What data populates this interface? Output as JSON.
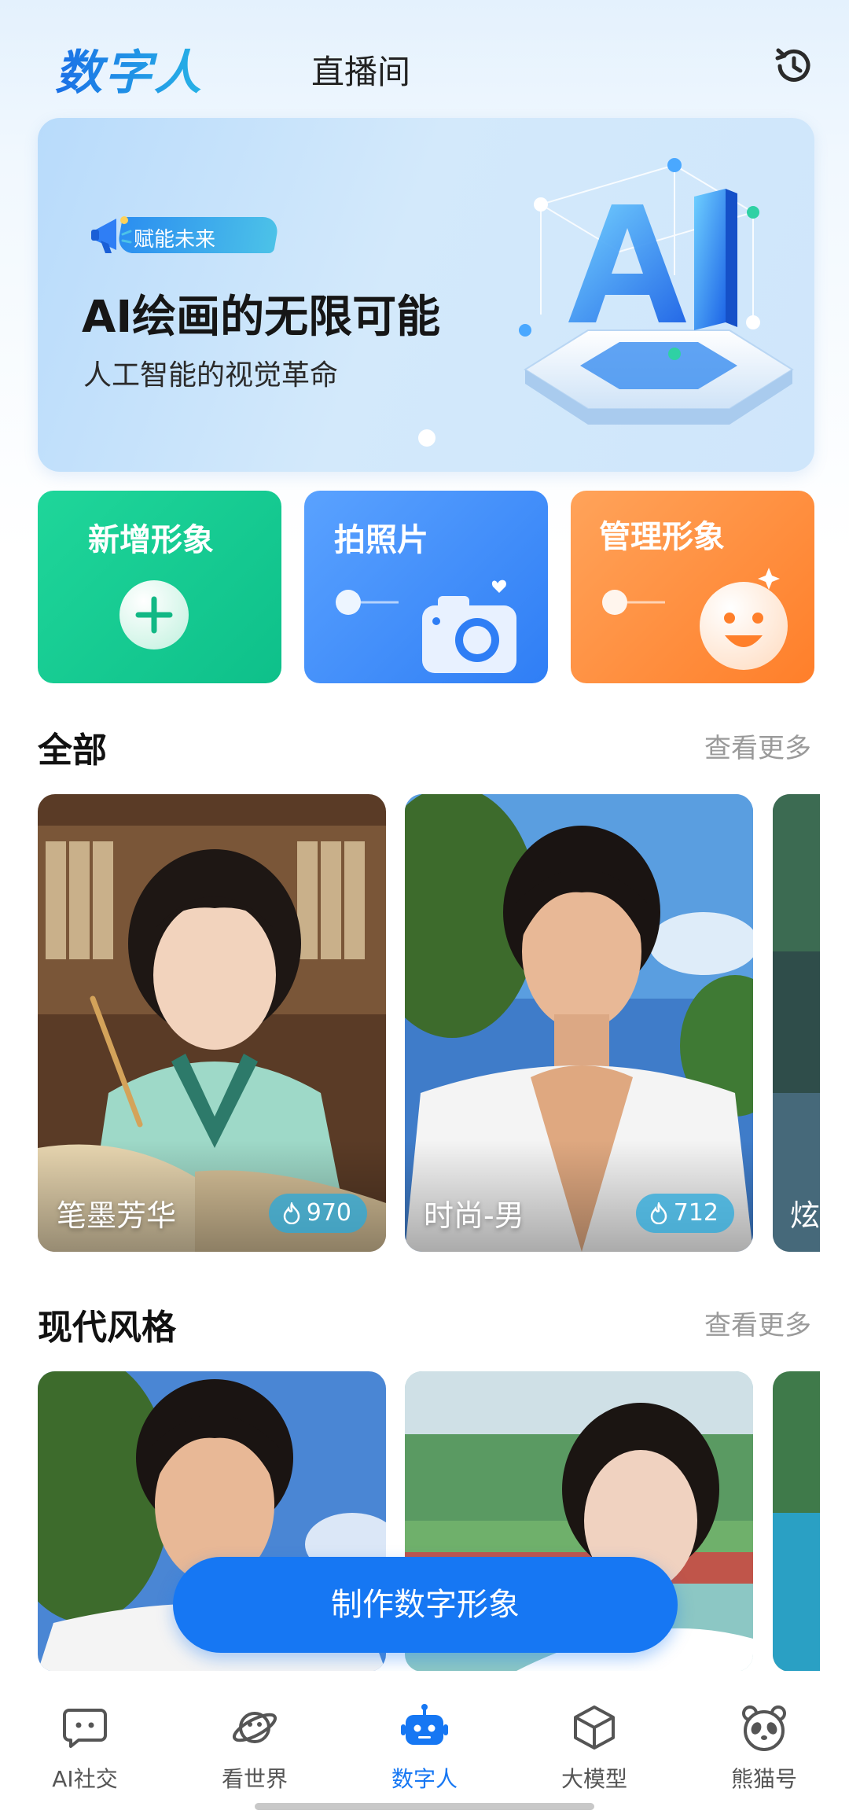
{
  "header": {
    "tabs": [
      {
        "label": "数字人",
        "active": true
      },
      {
        "label": "直播间",
        "active": false
      }
    ],
    "history_icon": "history-icon"
  },
  "banner": {
    "badge": "赋能未来",
    "title": "AI绘画的无限可能",
    "subtitle": "人工智能的视觉革命",
    "art_text": "AI",
    "page_index": 1,
    "page_count": 1
  },
  "actions": [
    {
      "label": "新增形象",
      "icon": "plus-icon",
      "color": "#12c98f"
    },
    {
      "label": "拍照片",
      "icon": "camera-icon",
      "color": "#3d8af7"
    },
    {
      "label": "管理形象",
      "icon": "smiley-icon",
      "color": "#ff8c3a"
    }
  ],
  "sections": [
    {
      "title": "全部",
      "more": "查看更多",
      "items": [
        {
          "name": "笔墨芳华",
          "count": "970"
        },
        {
          "name": "时尚-男",
          "count": "712"
        },
        {
          "name": "炫"
        }
      ]
    },
    {
      "title": "现代风格",
      "more": "查看更多",
      "items": [
        {
          "name": ""
        },
        {
          "name": ""
        },
        {
          "name": ""
        }
      ]
    }
  ],
  "cta": {
    "label": "制作数字形象"
  },
  "bottom_nav": [
    {
      "label": "AI社交",
      "icon": "chat-bubble-icon",
      "active": false
    },
    {
      "label": "看世界",
      "icon": "planet-icon",
      "active": false
    },
    {
      "label": "数字人",
      "icon": "robot-icon",
      "active": true
    },
    {
      "label": "大模型",
      "icon": "cube-icon",
      "active": false
    },
    {
      "label": "熊猫号",
      "icon": "panda-icon",
      "active": false
    }
  ],
  "colors": {
    "accent": "#1677f3",
    "green": "#12c98f",
    "blue": "#3d8af7",
    "orange": "#ff8c3a"
  }
}
